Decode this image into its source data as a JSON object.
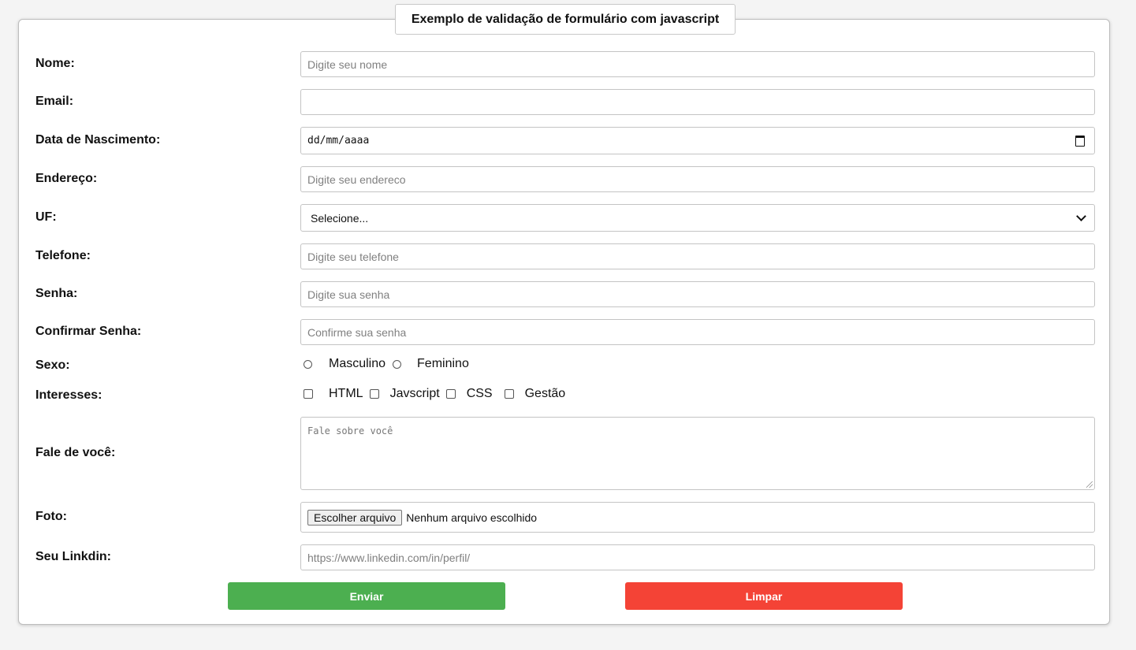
{
  "title": "Exemplo de validação de formulário com javascript",
  "fields": {
    "nome": {
      "label": "Nome:",
      "placeholder": "Digite seu nome"
    },
    "email": {
      "label": "Email:",
      "placeholder": ""
    },
    "nascimento": {
      "label": "Data de Nascimento:",
      "value": "dd/mm/aaaa"
    },
    "endereco": {
      "label": "Endereço:",
      "placeholder": "Digite seu endereco"
    },
    "uf": {
      "label": "UF:",
      "selected": "Selecione..."
    },
    "telefone": {
      "label": "Telefone:",
      "placeholder": "Digite seu telefone"
    },
    "senha": {
      "label": "Senha:",
      "placeholder": "Digite sua senha"
    },
    "confirmar": {
      "label": "Confirmar Senha:",
      "placeholder": "Confirme sua senha"
    },
    "sexo": {
      "label": "Sexo:",
      "options": [
        "Masculino",
        "Feminino"
      ]
    },
    "interesses": {
      "label": "Interesses:",
      "options": [
        "HTML",
        "Javscript",
        "CSS",
        "Gestão"
      ]
    },
    "fale": {
      "label": "Fale de você:",
      "placeholder": "Fale sobre você"
    },
    "foto": {
      "label": "Foto:",
      "button": "Escolher arquivo",
      "status": "Nenhum arquivo escolhido"
    },
    "linkedin": {
      "label": "Seu Linkdin:",
      "placeholder": "https://www.linkedin.com/in/perfil/"
    }
  },
  "buttons": {
    "submit": "Enviar",
    "reset": "Limpar"
  },
  "colors": {
    "submit_bg": "#4caf50",
    "reset_bg": "#f44336"
  },
  "icons": {
    "date": "calendar-icon",
    "select": "chevron-down-icon",
    "textarea": "resize-grip-icon"
  }
}
